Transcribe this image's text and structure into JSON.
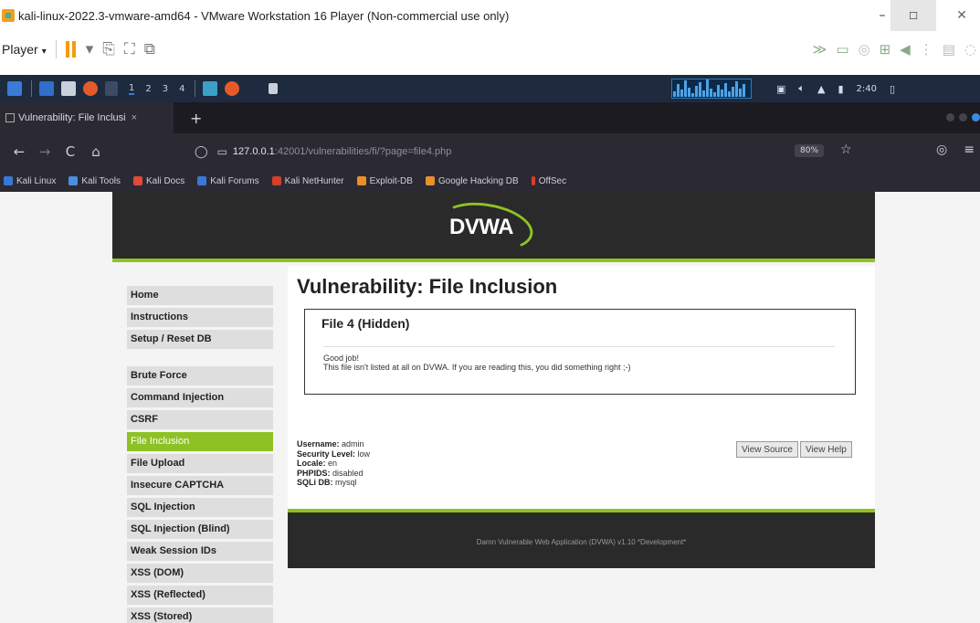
{
  "window": {
    "title": "kali-linux-2022.3-vmware-amd64 - VMware Workstation 16 Player (Non-commercial use only)",
    "controls": {
      "minimize": "–",
      "maximize": "☐",
      "close": "✕"
    }
  },
  "vm_toolbar": {
    "player_label": "Player",
    "caret": "▾"
  },
  "kali_panel": {
    "workspaces": [
      "1",
      "2",
      "3",
      "4"
    ],
    "clock": "2:40"
  },
  "browser": {
    "tab": {
      "title": "Vulnerability: File Inclusi",
      "close": "×"
    },
    "new_tab": "+",
    "url": {
      "host": "127.0.0.1",
      "path": ":42001/vulnerabilities/fi/?page=file4.php"
    },
    "zoom": "80%",
    "bookmarks": [
      "Kali Linux",
      "Kali Tools",
      "Kali Docs",
      "Kali Forums",
      "Kali NetHunter",
      "Exploit-DB",
      "Google Hacking DB",
      "OffSec"
    ]
  },
  "dvwa": {
    "logo": "DVWA",
    "menu_group_1": [
      "Home",
      "Instructions",
      "Setup / Reset DB"
    ],
    "menu_group_2": [
      "Brute Force",
      "Command Injection",
      "CSRF",
      "File Inclusion",
      "File Upload",
      "Insecure CAPTCHA",
      "SQL Injection",
      "SQL Injection (Blind)",
      "Weak Session IDs",
      "XSS (DOM)",
      "XSS (Reflected)",
      "XSS (Stored)"
    ],
    "selected_item": "File Inclusion",
    "main_title": "Vulnerability: File Inclusion",
    "box_title": "File 4 (Hidden)",
    "box_line_1": "Good job!",
    "box_line_2": "This file isn't listed at all on DVWA. If you are reading this, you did something right ;-)",
    "info": {
      "username_label": "Username:",
      "username": "admin",
      "security_label": "Security Level:",
      "security": "low",
      "locale_label": "Locale:",
      "locale": "en",
      "phpids_label": "PHPIDS:",
      "phpids": "disabled",
      "sqli_label": "SQLi DB:",
      "sqli": "mysql"
    },
    "view_source": "View Source",
    "view_help": "View Help",
    "footer": "Damn Vulnerable Web Application (DVWA) v1.10 *Development*"
  },
  "colors": {
    "dvwa_green": "#8ec224",
    "dvwa_dark": "#2a2a2a",
    "kali_panel": "#1e2a3e",
    "firefox_chrome": "#2b2a33"
  }
}
